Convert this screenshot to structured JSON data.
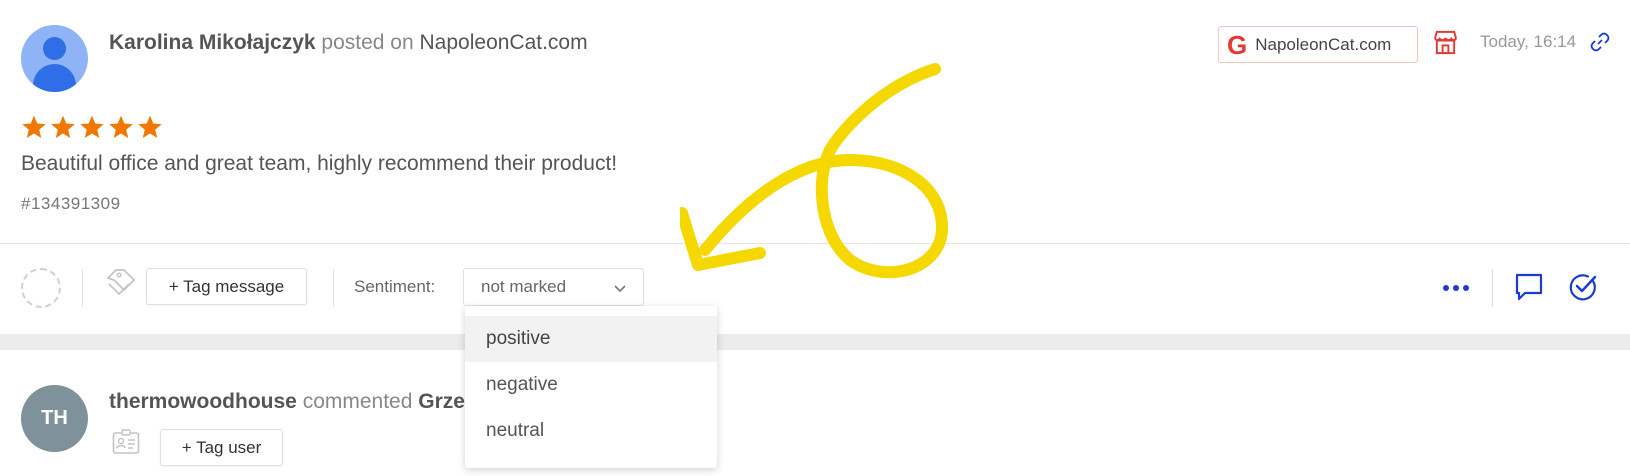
{
  "post": {
    "author": "Karolina Mikołajczyk",
    "action": "posted on",
    "target": "NapoleonCat.com",
    "platform_badge": "NapoleonCat.com",
    "platform_letter": "G",
    "timestamp": "Today, 16:14",
    "rating_stars": 5,
    "text": "Beautiful office and great team, highly recommend their product!",
    "id": "#134391309"
  },
  "toolbar": {
    "tag_message_label": "+ Tag message",
    "sentiment_label": "Sentiment:",
    "sentiment_value": "not marked"
  },
  "sentiment_dropdown": {
    "options": [
      "positive",
      "negative",
      "neutral"
    ],
    "hovered": "positive"
  },
  "comment": {
    "avatar_initials": "TH",
    "author": "thermowoodhouse",
    "action": "commented",
    "target": "Grze",
    "tag_user_label": "+ Tag user"
  },
  "icons": {
    "status": "dashed-circle-icon",
    "tag": "tag-icon",
    "more": "more-dots-icon",
    "reply": "reply-bubble-icon",
    "resolve": "check-circle-icon",
    "store": "store-icon",
    "link": "link-icon",
    "contact": "contact-card-icon",
    "chevron": "chevron-down-icon"
  },
  "colors": {
    "accent_blue": "#1a3bd6",
    "star_orange": "#f07800",
    "badge_red": "#e53935",
    "annotation_yellow": "#f5d800"
  }
}
